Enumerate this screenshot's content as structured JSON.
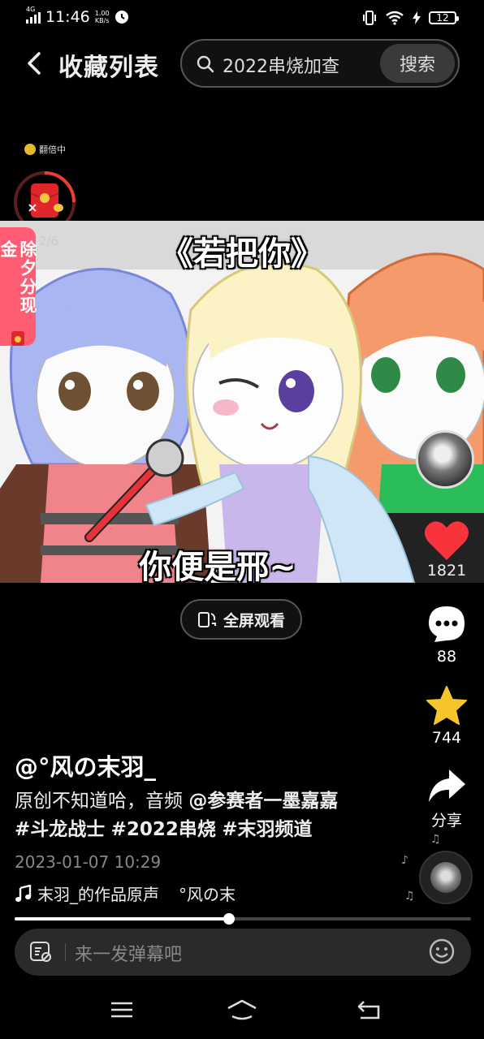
{
  "status_bar": {
    "network": "4G",
    "time": "11:46",
    "speed_value": "1.00",
    "speed_unit": "KB/s",
    "battery": "12"
  },
  "header": {
    "title": "收藏列表",
    "search_query": "2022串烧加查",
    "search_button": "搜索"
  },
  "reward": {
    "double_label": "翻倍中",
    "progress": "2/6",
    "cny_label": "除夕分现金"
  },
  "video": {
    "caption_top": "《若把你》",
    "caption_bottom": "你便是邢~"
  },
  "actions": {
    "likes": "1821",
    "comments": "88",
    "favorites": "744",
    "share_label": "分享"
  },
  "fullscreen_label": "全屏观看",
  "post": {
    "author": "@°风の末羽_",
    "desc_prefix": "原创不知道哈，音频 ",
    "mention": "@参赛者一墨嘉嘉",
    "hashtags": [
      "#斗龙战士",
      "#2022串烧",
      "#末羽频道"
    ],
    "date": "2023-01-07 10:29",
    "music": "末羽_的作品原声",
    "music_author": "°风の末"
  },
  "playback": {
    "progress_fraction": 0.47
  },
  "danmaku": {
    "placeholder": "来一发弹幕吧"
  }
}
